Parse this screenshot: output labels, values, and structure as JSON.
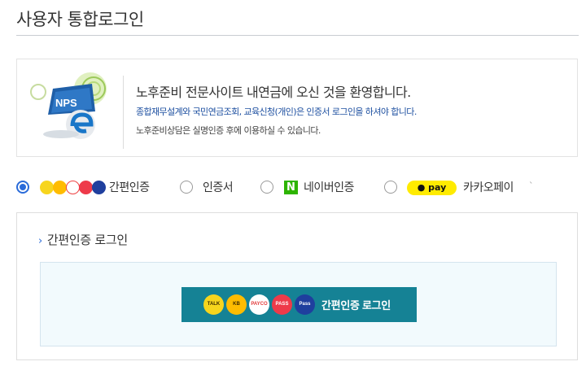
{
  "header": {
    "title": "사용자 통합로그인"
  },
  "welcome": {
    "logo_text": "NPS",
    "title": "노후준비 전문사이트 내연금에 오신 것을 환영합니다.",
    "line1": "종합재무설계와 국민연금조회, 교육신청(개인)은 인증서 로그인을 하셔야 합니다.",
    "line2": "노후준비상담은 실명인증 후에 이용하실 수 있습니다."
  },
  "login_methods": {
    "selected": "simple",
    "options": [
      {
        "id": "simple",
        "label": "간편인증"
      },
      {
        "id": "certificate",
        "label": "인증서"
      },
      {
        "id": "naver",
        "label": "네이버인증",
        "badge": "N"
      },
      {
        "id": "kakaopay",
        "label": "카카오페이",
        "badge": "pay"
      }
    ]
  },
  "panel": {
    "heading": "간편인증 로그인",
    "button_label": "간편인증 로그인",
    "providers": [
      {
        "name": "TALK",
        "color": "#f7d51d",
        "icon": "kakaotalk-icon"
      },
      {
        "name": "KB",
        "color": "#ffbc00",
        "icon": "kb-icon"
      },
      {
        "name": "PAYCO",
        "color": "#ffffff",
        "icon": "payco-icon"
      },
      {
        "name": "PASS",
        "color": "#ee3a4a",
        "icon": "pass-icon"
      },
      {
        "name": "Pass",
        "color": "#1f3f9e",
        "icon": "samsung-pass-icon"
      }
    ]
  },
  "colors": {
    "accent": "#2a6bd9",
    "button": "#158295",
    "naver": "#2db400",
    "kakaopay": "#ffeb00"
  }
}
